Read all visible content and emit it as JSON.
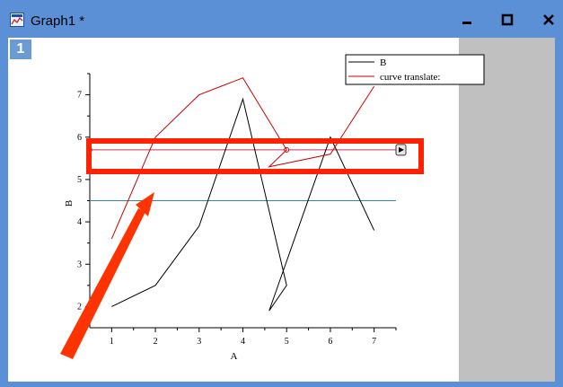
{
  "window": {
    "title": "Graph1 *",
    "layer_number": "1",
    "accent_color": "#5b8fd6"
  },
  "legend": {
    "entries": [
      {
        "label": "B",
        "color": "#000000"
      },
      {
        "label": "curve translate:",
        "color": "#cc0000"
      }
    ]
  },
  "chart_data": {
    "type": "line",
    "xlabel": "A",
    "ylabel": "B",
    "xlim": [
      0.5,
      7.5
    ],
    "ylim": [
      1.5,
      7.5
    ],
    "x_ticks": [
      "1",
      "2",
      "3",
      "4",
      "5",
      "6",
      "7"
    ],
    "y_ticks": [
      "2",
      "3",
      "4",
      "5",
      "6",
      "7"
    ],
    "series": [
      {
        "name": "B",
        "color": "#000000",
        "x": [
          1,
          2,
          3,
          4,
          5,
          4.6,
          6,
          7
        ],
        "y": [
          2,
          2.5,
          3.9,
          6.9,
          2.5,
          1.9,
          6.0,
          3.8
        ]
      },
      {
        "name": "curve translate:",
        "color": "#cc0000",
        "x": [
          1,
          2,
          3,
          4,
          5,
          4.6,
          6,
          7
        ],
        "y": [
          3.6,
          6.0,
          7.0,
          7.4,
          5.7,
          5.3,
          5.6,
          7.2
        ]
      }
    ],
    "reference_lines": [
      {
        "y": 5.7,
        "color": "#cc3355"
      },
      {
        "y": 4.5,
        "color": "#2e8b9a"
      }
    ]
  },
  "annotations": {
    "highlight_box_color": "#ff2200",
    "arrow_color": "#ff3300"
  }
}
